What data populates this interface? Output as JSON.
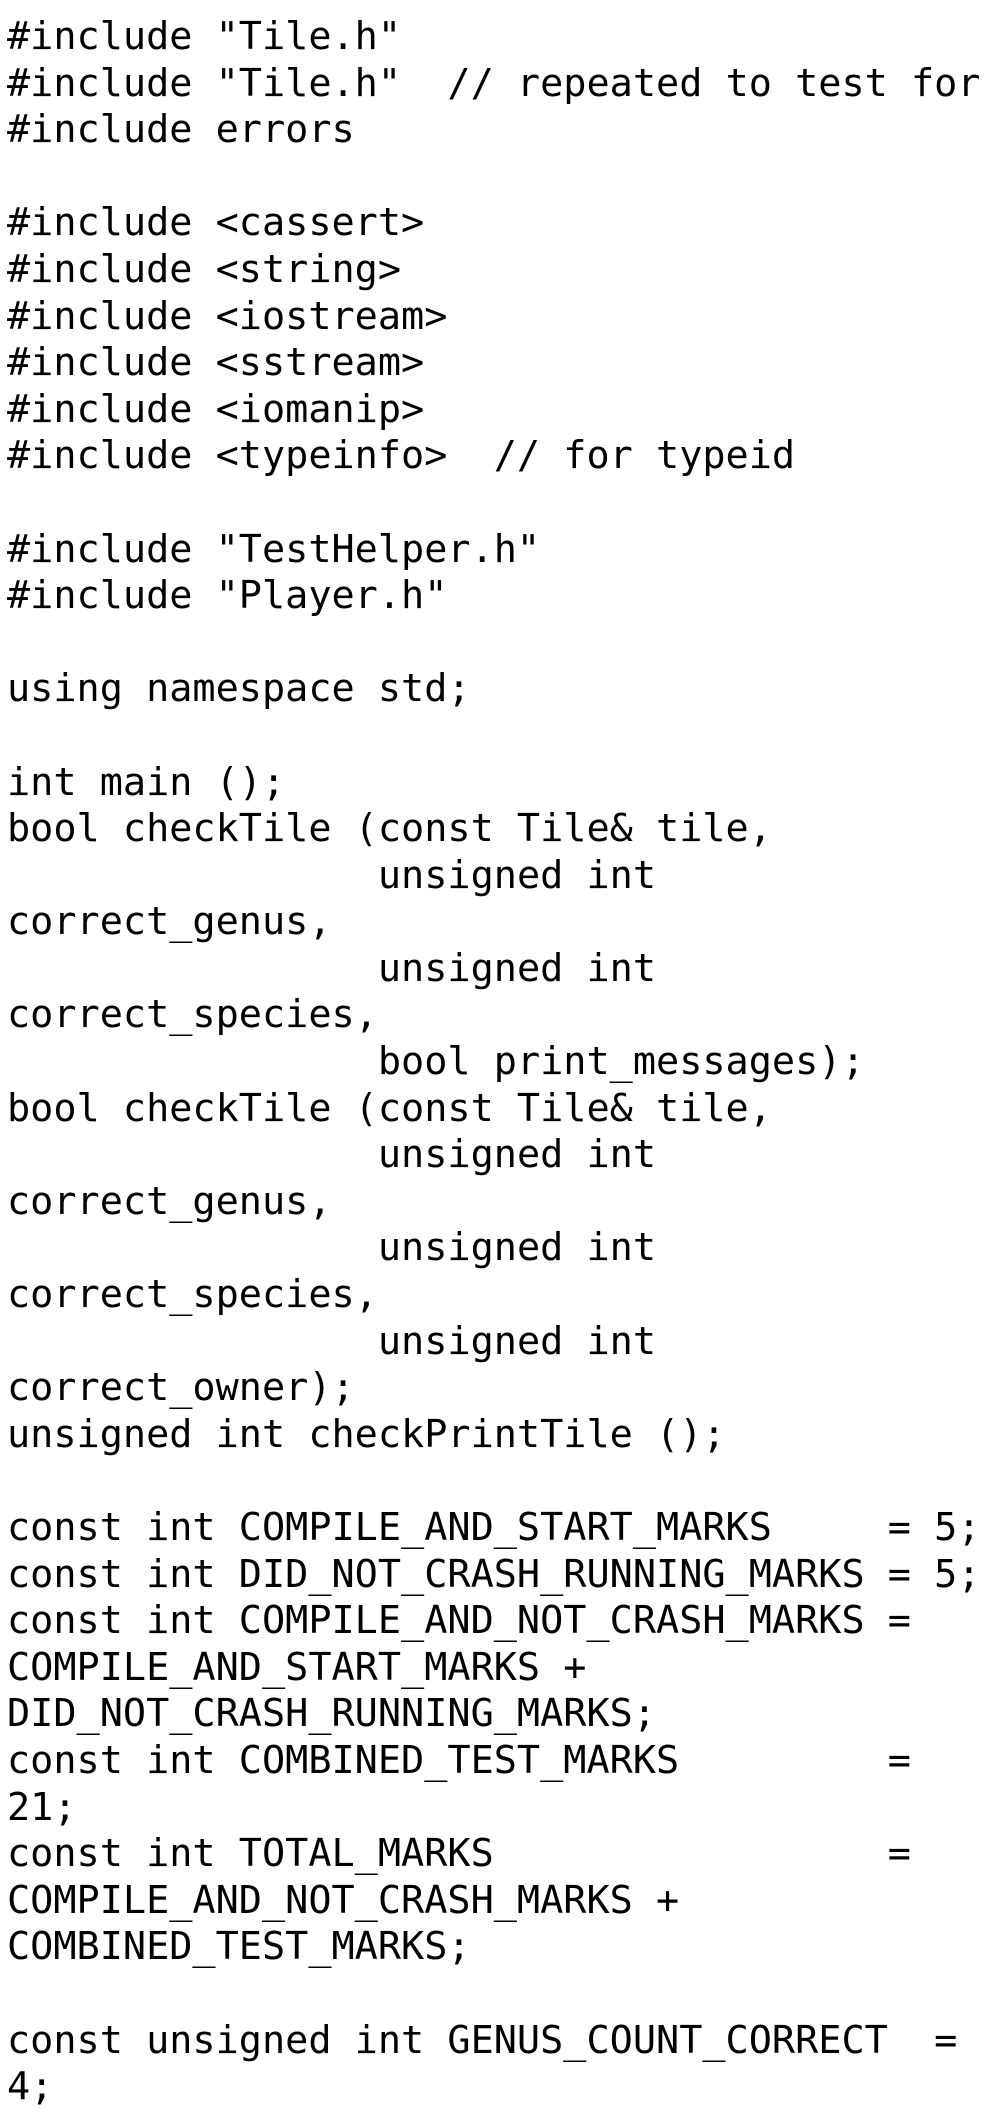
{
  "document": {
    "kind": "source-code-listing",
    "language": "C++",
    "colors": {
      "background": "#ffffff",
      "text": "#000000"
    },
    "lines": [
      "#include \"Tile.h\"",
      "#include \"Tile.h\"  // repeated to test for #include errors",
      "",
      "#include <cassert>",
      "#include <string>",
      "#include <iostream>",
      "#include <sstream>",
      "#include <iomanip>",
      "#include <typeinfo>  // for typeid",
      "",
      "#include \"TestHelper.h\"",
      "#include \"Player.h\"",
      "",
      "using namespace std;",
      "",
      "int main ();",
      "bool checkTile (const Tile& tile,",
      "                unsigned int correct_genus,",
      "                unsigned int correct_species,",
      "                bool print_messages);",
      "bool checkTile (const Tile& tile,",
      "                unsigned int correct_genus,",
      "                unsigned int correct_species,",
      "                unsigned int correct_owner);",
      "unsigned int checkPrintTile ();",
      "",
      "const int COMPILE_AND_START_MARKS     = 5;",
      "const int DID_NOT_CRASH_RUNNING_MARKS = 5;",
      "const int COMPILE_AND_NOT_CRASH_MARKS = COMPILE_AND_START_MARKS + DID_NOT_CRASH_RUNNING_MARKS;",
      "const int COMBINED_TEST_MARKS         = 21;",
      "const int TOTAL_MARKS                 = COMPILE_AND_NOT_CRASH_MARKS + COMBINED_TEST_MARKS;",
      "",
      "const unsigned int GENUS_COUNT_CORRECT  = 4;"
    ],
    "text": "#include \"Tile.h\"\n#include \"Tile.h\"  // repeated to test for #include errors\n\n#include <cassert>\n#include <string>\n#include <iostream>\n#include <sstream>\n#include <iomanip>\n#include <typeinfo>  // for typeid\n\n#include \"TestHelper.h\"\n#include \"Player.h\"\n\nusing namespace std;\n\nint main ();\nbool checkTile (const Tile& tile,\n                unsigned int correct_genus,\n                unsigned int correct_species,\n                bool print_messages);\nbool checkTile (const Tile& tile,\n                unsigned int correct_genus,\n                unsigned int correct_species,\n                unsigned int correct_owner);\nunsigned int checkPrintTile ();\n\nconst int COMPILE_AND_START_MARKS     = 5;\nconst int DID_NOT_CRASH_RUNNING_MARKS = 5;\nconst int COMPILE_AND_NOT_CRASH_MARKS = COMPILE_AND_START_MARKS + DID_NOT_CRASH_RUNNING_MARKS;\nconst int COMBINED_TEST_MARKS         = 21;\nconst int TOTAL_MARKS                 = COMPILE_AND_NOT_CRASH_MARKS + COMBINED_TEST_MARKS;\n\nconst unsigned int GENUS_COUNT_CORRECT  = 4;\n"
  }
}
